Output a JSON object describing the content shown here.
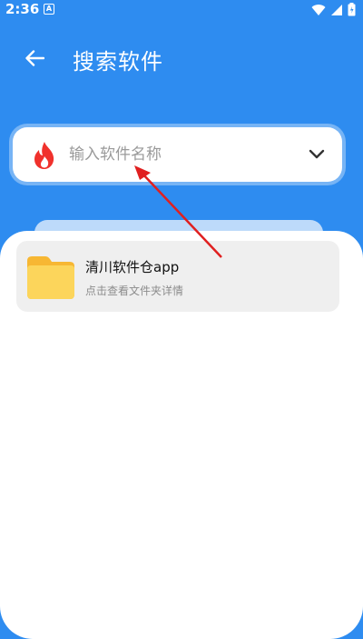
{
  "status_bar": {
    "time": "2:36",
    "notification_icon": "A"
  },
  "header": {
    "title": "搜索软件",
    "back_icon": "arrow-left-icon"
  },
  "search": {
    "placeholder": "输入软件名称",
    "value": "",
    "leading_icon": "fire-icon",
    "trailing_icon": "chevron-down-icon"
  },
  "results": [
    {
      "title": "清川软件仓app",
      "subtitle": "点击查看文件夹详情",
      "icon": "folder-icon"
    }
  ],
  "colors": {
    "primary": "#2e8cf0",
    "fire": "#f0312c",
    "folder": "#fcd55b",
    "annotation": "#e02020"
  }
}
